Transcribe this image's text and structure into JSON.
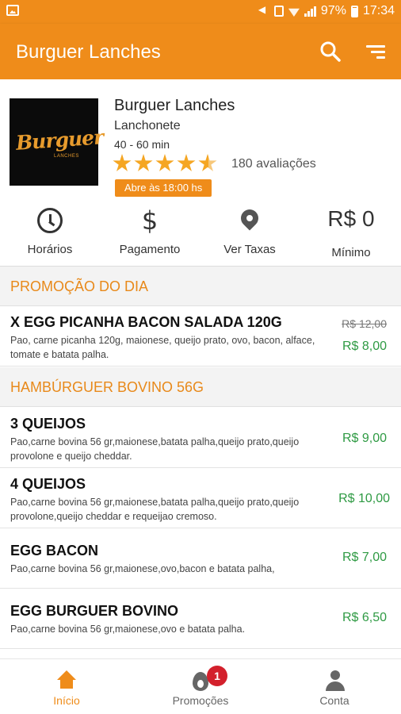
{
  "status_bar": {
    "battery": "97%",
    "time": "17:34"
  },
  "app_bar": {
    "title": "Burguer Lanches"
  },
  "restaurant": {
    "logo_text": "Burguer",
    "logo_subtext": "LANCHES",
    "name": "Burguer Lanches",
    "category": "Lanchonete",
    "delivery_time": "40 - 60 min",
    "rating": 4.5,
    "reviews": "180 avaliações",
    "open_badge": "Abre às 18:00 hs"
  },
  "quick_actions": {
    "hours_label": "Horários",
    "payment_label": "Pagamento",
    "fees_label": "Ver Taxas",
    "minimum_value": "R$ 0",
    "minimum_label": "Mínimo"
  },
  "sections": [
    {
      "title": "PROMOÇÃO DO DIA",
      "items": [
        {
          "name": "X EGG PICANHA BACON SALADA 120G",
          "description": "Pao, carne picanha 120g, maionese, queijo prato, ovo, bacon, alface, tomate e batata palha.",
          "old_price": "R$ 12,00",
          "price": "R$ 8,00"
        }
      ]
    },
    {
      "title": "HAMBÚRGUER BOVINO 56G",
      "items": [
        {
          "name": "3 QUEIJOS",
          "description": "Pao,carne bovina 56 gr,maionese,batata palha,queijo prato,queijo provolone e queijo cheddar.",
          "price": "R$ 9,00"
        },
        {
          "name": "4 QUEIJOS",
          "description": "Pao,carne bovina 56 gr,maionese,batata palha,queijo prato,queijo provolone,queijo cheddar e requeijao cremoso.",
          "price": "R$ 10,00"
        },
        {
          "name": "EGG BACON",
          "description": "Pao,carne bovina 56 gr,maionese,ovo,bacon e batata palha,",
          "price": "R$ 7,00"
        },
        {
          "name": "EGG BURGUER BOVINO",
          "description": "Pao,carne bovina 56 gr,maionese,ovo e batata palha.",
          "price": "R$ 6,50"
        }
      ]
    }
  ],
  "bottom_nav": {
    "home_label": "Início",
    "promos_label": "Promoções",
    "promos_badge": "1",
    "account_label": "Conta"
  },
  "colors": {
    "primary": "#ef8c1a",
    "price_green": "#2e9a43",
    "badge_red": "#d3202c"
  },
  "icons": [
    "image-icon",
    "mute-icon",
    "vibrate-icon",
    "wifi-icon",
    "signal-icon",
    "battery-icon",
    "search-icon",
    "filter-icon",
    "clock-icon",
    "dollar-icon",
    "map-pin-icon",
    "home-icon",
    "fire-icon",
    "account-icon",
    "star-icon"
  ]
}
